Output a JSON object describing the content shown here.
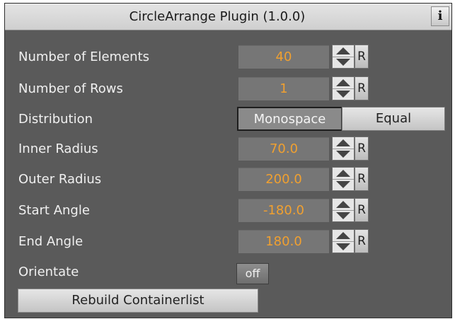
{
  "panel": {
    "title": "CircleArrange Plugin (1.0.0)",
    "info_glyph": "i"
  },
  "fields": {
    "number_of_elements": {
      "label": "Number of Elements",
      "value": "40",
      "reset": "R"
    },
    "number_of_rows": {
      "label": "Number of Rows",
      "value": "1",
      "reset": "R"
    },
    "inner_radius": {
      "label": "Inner Radius",
      "value": "70.0",
      "reset": "R"
    },
    "outer_radius": {
      "label": "Outer Radius",
      "value": "200.0",
      "reset": "R"
    },
    "start_angle": {
      "label": "Start Angle",
      "value": "-180.0",
      "reset": "R"
    },
    "end_angle": {
      "label": "End Angle",
      "value": "180.0",
      "reset": "R"
    }
  },
  "distribution": {
    "label": "Distribution",
    "options": [
      "Monospace",
      "Equal"
    ],
    "selected": "Monospace"
  },
  "orientate": {
    "label": "Orientate",
    "value": "off"
  },
  "rebuild_button": {
    "label": "Rebuild Containerlist"
  },
  "colors": {
    "panel_bg": "#5a5a5a",
    "value_text": "#f0a030",
    "label_text": "#f0f0f0"
  }
}
